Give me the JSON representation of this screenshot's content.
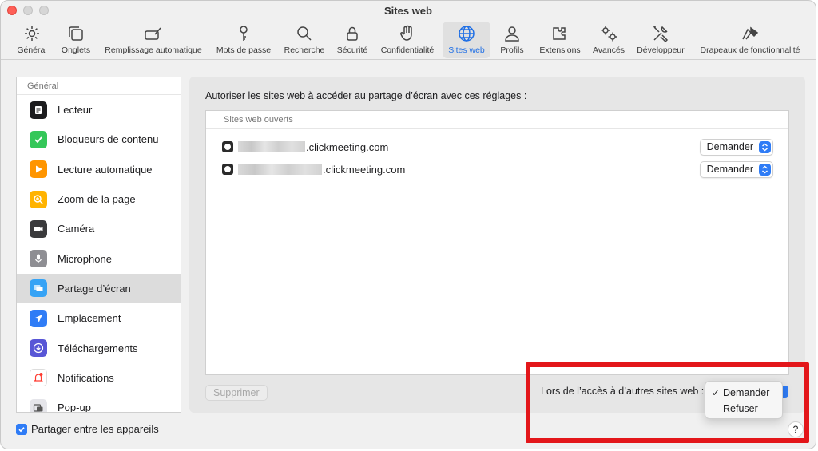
{
  "window": {
    "title": "Sites web"
  },
  "toolbar": {
    "items": [
      {
        "label": "Général",
        "icon": "gear-icon"
      },
      {
        "label": "Onglets",
        "icon": "tabs-icon"
      },
      {
        "label": "Remplissage automatique",
        "icon": "autofill-icon"
      },
      {
        "label": "Mots de passe",
        "icon": "key-icon"
      },
      {
        "label": "Recherche",
        "icon": "magnifier-icon"
      },
      {
        "label": "Sécurité",
        "icon": "lock-icon"
      },
      {
        "label": "Confidentialité",
        "icon": "hand-icon"
      },
      {
        "label": "Sites web",
        "icon": "globe-icon",
        "active": true
      },
      {
        "label": "Profils",
        "icon": "person-icon"
      },
      {
        "label": "Extensions",
        "icon": "puzzle-icon"
      },
      {
        "label": "Avancés",
        "icon": "gears-icon"
      },
      {
        "label": "Développeur",
        "icon": "tools-icon"
      },
      {
        "label": "Drapeaux de fonctionnalité",
        "icon": "flags-icon"
      }
    ]
  },
  "sidebar": {
    "header": "Général",
    "items": [
      {
        "label": "Lecteur",
        "icon": "reader-icon",
        "color": "#1c1c1e"
      },
      {
        "label": "Bloqueurs de contenu",
        "icon": "checkmark-shield-icon",
        "color": "#34c759"
      },
      {
        "label": "Lecture automatique",
        "icon": "play-icon",
        "color": "#ff9500"
      },
      {
        "label": "Zoom de la page",
        "icon": "zoom-icon",
        "color": "#ffb300"
      },
      {
        "label": "Caméra",
        "icon": "camera-icon",
        "color": "#3a3a3c"
      },
      {
        "label": "Microphone",
        "icon": "microphone-icon",
        "color": "#8e8e93"
      },
      {
        "label": "Partage d’écran",
        "icon": "screen-share-icon",
        "color": "#36a3f5",
        "selected": true
      },
      {
        "label": "Emplacement",
        "icon": "location-icon",
        "color": "#2f7cf6"
      },
      {
        "label": "Téléchargements",
        "icon": "download-icon",
        "color": "#5856d6"
      },
      {
        "label": "Notifications",
        "icon": "bell-icon",
        "color": "#ff3b30"
      },
      {
        "label": "Pop-up",
        "icon": "popup-icon",
        "color": "#8e8e93"
      }
    ]
  },
  "main": {
    "description": "Autoriser les sites web à accéder au partage d’écran avec ces réglages :",
    "sites_header": "Sites web ouverts",
    "sites": [
      {
        "domain": ".clickmeeting.com",
        "value": "Demander"
      },
      {
        "domain": ".clickmeeting.com",
        "value": "Demander"
      }
    ],
    "delete_label": "Supprimer",
    "other_sites_label": "Lors de l’accès à d’autres sites web :",
    "other_sites_options": [
      "Demander",
      "Refuser"
    ],
    "other_sites_selected": "Demander",
    "check_mark": "✓"
  },
  "footer": {
    "share_label": "Partager entre les appareils",
    "share_checked": true,
    "help_label": "?"
  },
  "colors": {
    "accent": "#2f7cf6",
    "highlight": "#e3161a"
  }
}
